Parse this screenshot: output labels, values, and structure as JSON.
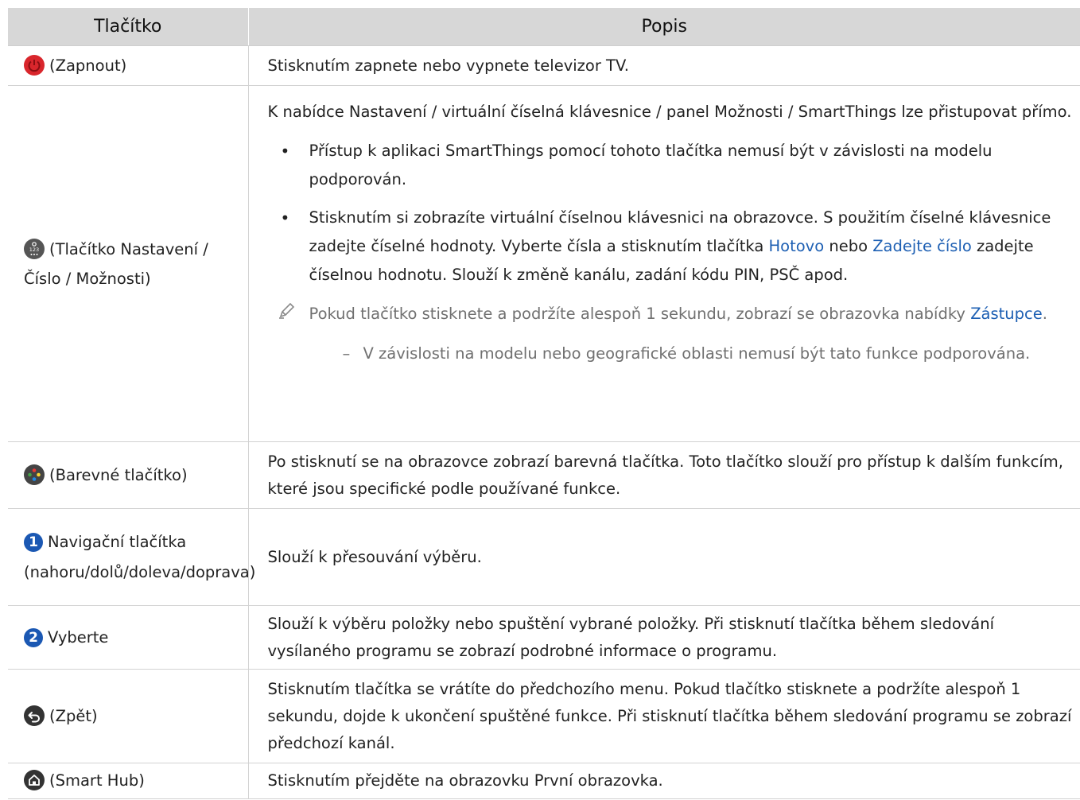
{
  "header": {
    "col1": "Tlačítko",
    "col2": "Popis"
  },
  "rows": [
    {
      "button_label": "(Zapnout)",
      "icon": "power-icon",
      "desc": "Stisknutím zapnete nebo vypnete televizor TV."
    },
    {
      "button_label": "(Tlačítko Nastavení / Číslo / Možnosti)",
      "icon": "settings-number-icon",
      "desc": "K nabídce Nastavení / virtuální číselná klávesnice / panel Možnosti / SmartThings lze přistupovat přímo.",
      "bullet1": "Přístup k aplikaci SmartThings pomocí tohoto tlačítka nemusí být v závislosti na modelu podporován.",
      "bullet2_a": "Stisknutím si zobrazíte virtuální číselnou klávesnici na obrazovce. S použitím číselné klávesnice zadejte číselné hodnoty. Vyberte čísla a stisknutím tlačítka ",
      "bullet2_link1": "Hotovo",
      "bullet2_b": " nebo ",
      "bullet2_link2": "Zadejte číslo",
      "bullet2_c": " zadejte číselnou hodnotu. Slouží k změně kanálu, zadání kódu PIN, PSČ apod.",
      "note_a": "Pokud tlačítko stisknete a podržíte alespoň 1 sekundu, zobrazí se obrazovka nabídky ",
      "note_link": "Zástupce",
      "note_b": ".",
      "subnote": "V závislosti na modelu nebo geografické oblasti nemusí být tato funkce podporována."
    },
    {
      "button_label": "(Barevné tlačítko)",
      "icon": "color-button-icon",
      "desc": "Po stisknutí se na obrazovce zobrazí barevná tlačítka. Toto tlačítko slouží pro přístup k dalším funkcím, které jsou specifické podle používané funkce."
    },
    {
      "button_label": "Navigační tlačítka (nahoru/dolů/doleva/doprava)",
      "badge": "1",
      "desc": "Slouží k přesouvání výběru."
    },
    {
      "button_label": "Vyberte",
      "badge": "2",
      "desc": "Slouží k výběru položky nebo spuštění vybrané položky. Při stisknutí tlačítka během sledování vysílaného programu se zobrazí podrobné informace o programu."
    },
    {
      "button_label": "(Zpět)",
      "icon": "back-icon",
      "desc": "Stisknutím tlačítka se vrátíte do předchozího menu. Pokud tlačítko stisknete a podržíte alespoň 1 sekundu, dojde k ukončení spuštěné funkce. Při stisknutí tlačítka během sledování programu se zobrazí předchozí kanál."
    },
    {
      "button_label": "(Smart Hub)",
      "icon": "home-icon",
      "desc": "Stisknutím přejděte na obrazovku První obrazovka."
    }
  ],
  "bullet_char": "•",
  "dash_char": "–",
  "colors": {
    "header_bg": "#d7d7d7",
    "link": "#1d5fb3",
    "power_red": "#d9262c",
    "badge_blue": "#1b58b3"
  }
}
